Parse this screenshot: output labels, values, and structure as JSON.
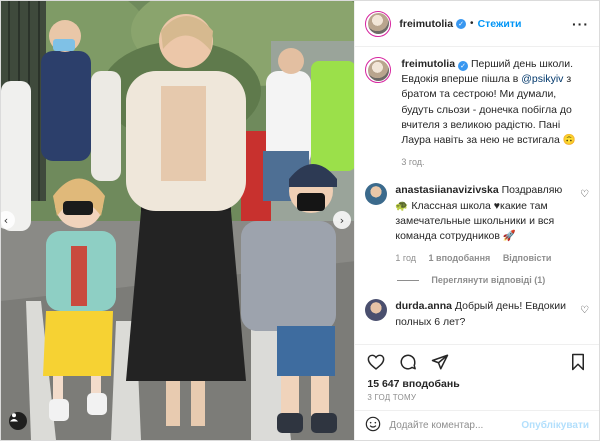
{
  "post": {
    "author": {
      "username": "freimutolia",
      "verified": true,
      "follow_label": "Стежити",
      "separator": "•"
    },
    "caption": {
      "username": "freimutolia",
      "text_before": " Перший день школи. Евдокія вперше пішла в ",
      "mention": "@psikyiv",
      "text_after": " з братом та сестрою! Ми думали, будуть сльози - донечка побігла до вчителя з великою радістю. Пані Лаура навіть за нею не встигала 🙃",
      "time": "3 год."
    },
    "comments": [
      {
        "username": "anastasiianavizivska",
        "text": " Поздравляю 🐢 Классная школа ♥какие там замечательные школьники и вся команда сотрудников 🚀",
        "time": "1 год",
        "likes": "1 вподобання",
        "reply_label": "Відповісти",
        "avatar_color": "#3b6a8c",
        "replies_label": "Переглянути відповіді (1)"
      },
      {
        "username": "durda.anna",
        "text": " Добрый день! Евдокии полных 6 лет?",
        "avatar_color": "#4a4f6e"
      }
    ],
    "likes_count": "15 647 вподобань",
    "time_ago": "3 ГОД ТОМУ",
    "comment_placeholder": "Додайте коментар...",
    "publish_label": "Опублікувати"
  },
  "icons": {
    "heart": "heart-icon",
    "comment": "comment-icon",
    "share": "share-icon",
    "bookmark": "bookmark-icon",
    "emoji": "emoji-icon",
    "more": "more-options-icon",
    "tag": "user-tag-icon"
  },
  "colors": {
    "accent": "#0095f6",
    "verified": "#3897f0",
    "muted": "#8e8e8e",
    "publish_disabled": "#b2dffc"
  }
}
